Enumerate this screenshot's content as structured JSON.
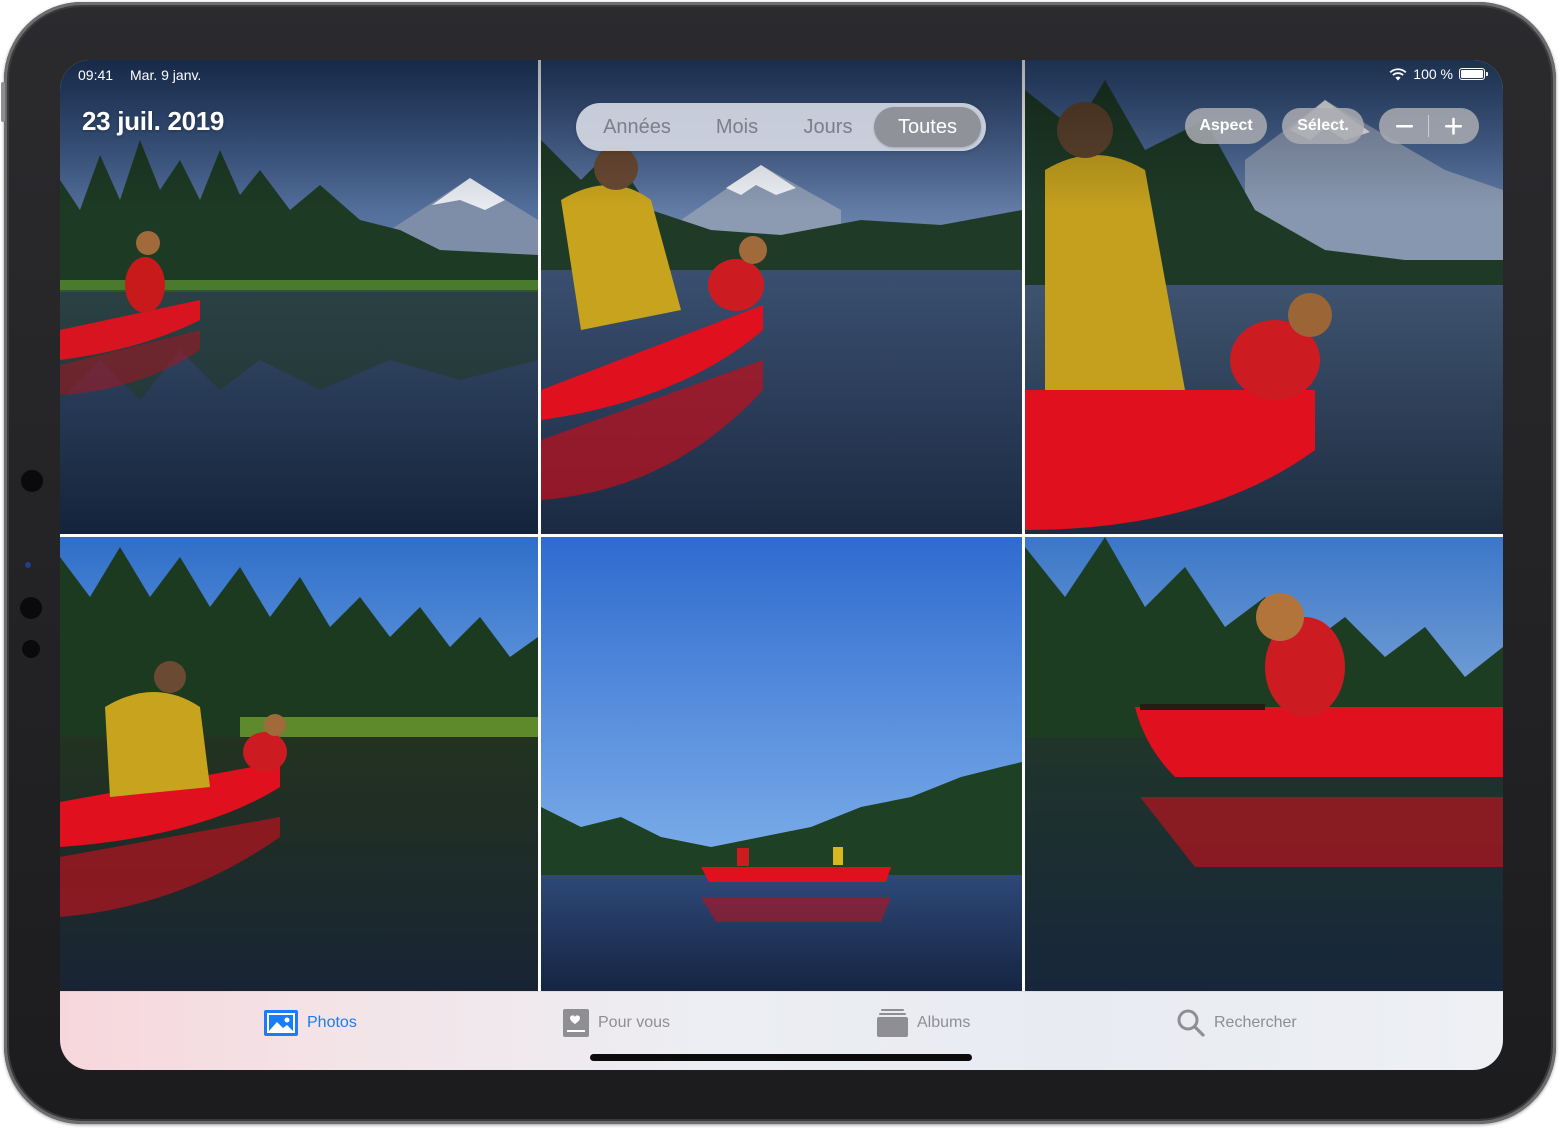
{
  "status_bar": {
    "time": "09:41",
    "date": "Mar. 9 janv.",
    "battery": "100 %"
  },
  "header": {
    "date_title": "23 juil. 2019"
  },
  "view_switcher": {
    "segments": [
      "Années",
      "Mois",
      "Jours",
      "Toutes"
    ],
    "selected": "Toutes"
  },
  "toolbar": {
    "aspect_label": "Aspect",
    "select_label": "Sélect.",
    "zoom_out_icon": "minus-icon",
    "zoom_in_icon": "plus-icon"
  },
  "photos": [
    {
      "subject": "woman-in-red-canoe-mountain-lake"
    },
    {
      "subject": "man-and-woman-in-canoe-facing-mountain"
    },
    {
      "subject": "man-and-woman-in-canoe-closeup"
    },
    {
      "subject": "couple-in-canoe-by-forest-shore"
    },
    {
      "subject": "distant-red-canoe-wide-sky"
    },
    {
      "subject": "woman-in-canoe-holding-paddle"
    }
  ],
  "tab_bar": {
    "tabs": [
      {
        "label": "Photos",
        "icon": "photos-icon",
        "active": true
      },
      {
        "label": "Pour vous",
        "icon": "for-you-icon",
        "active": false
      },
      {
        "label": "Albums",
        "icon": "albums-icon",
        "active": false
      },
      {
        "label": "Rechercher",
        "icon": "search-icon",
        "active": false
      }
    ]
  },
  "colors": {
    "accent": "#1a7cf6",
    "canoe": "#e0101e",
    "sky": "#3d7fd6"
  }
}
